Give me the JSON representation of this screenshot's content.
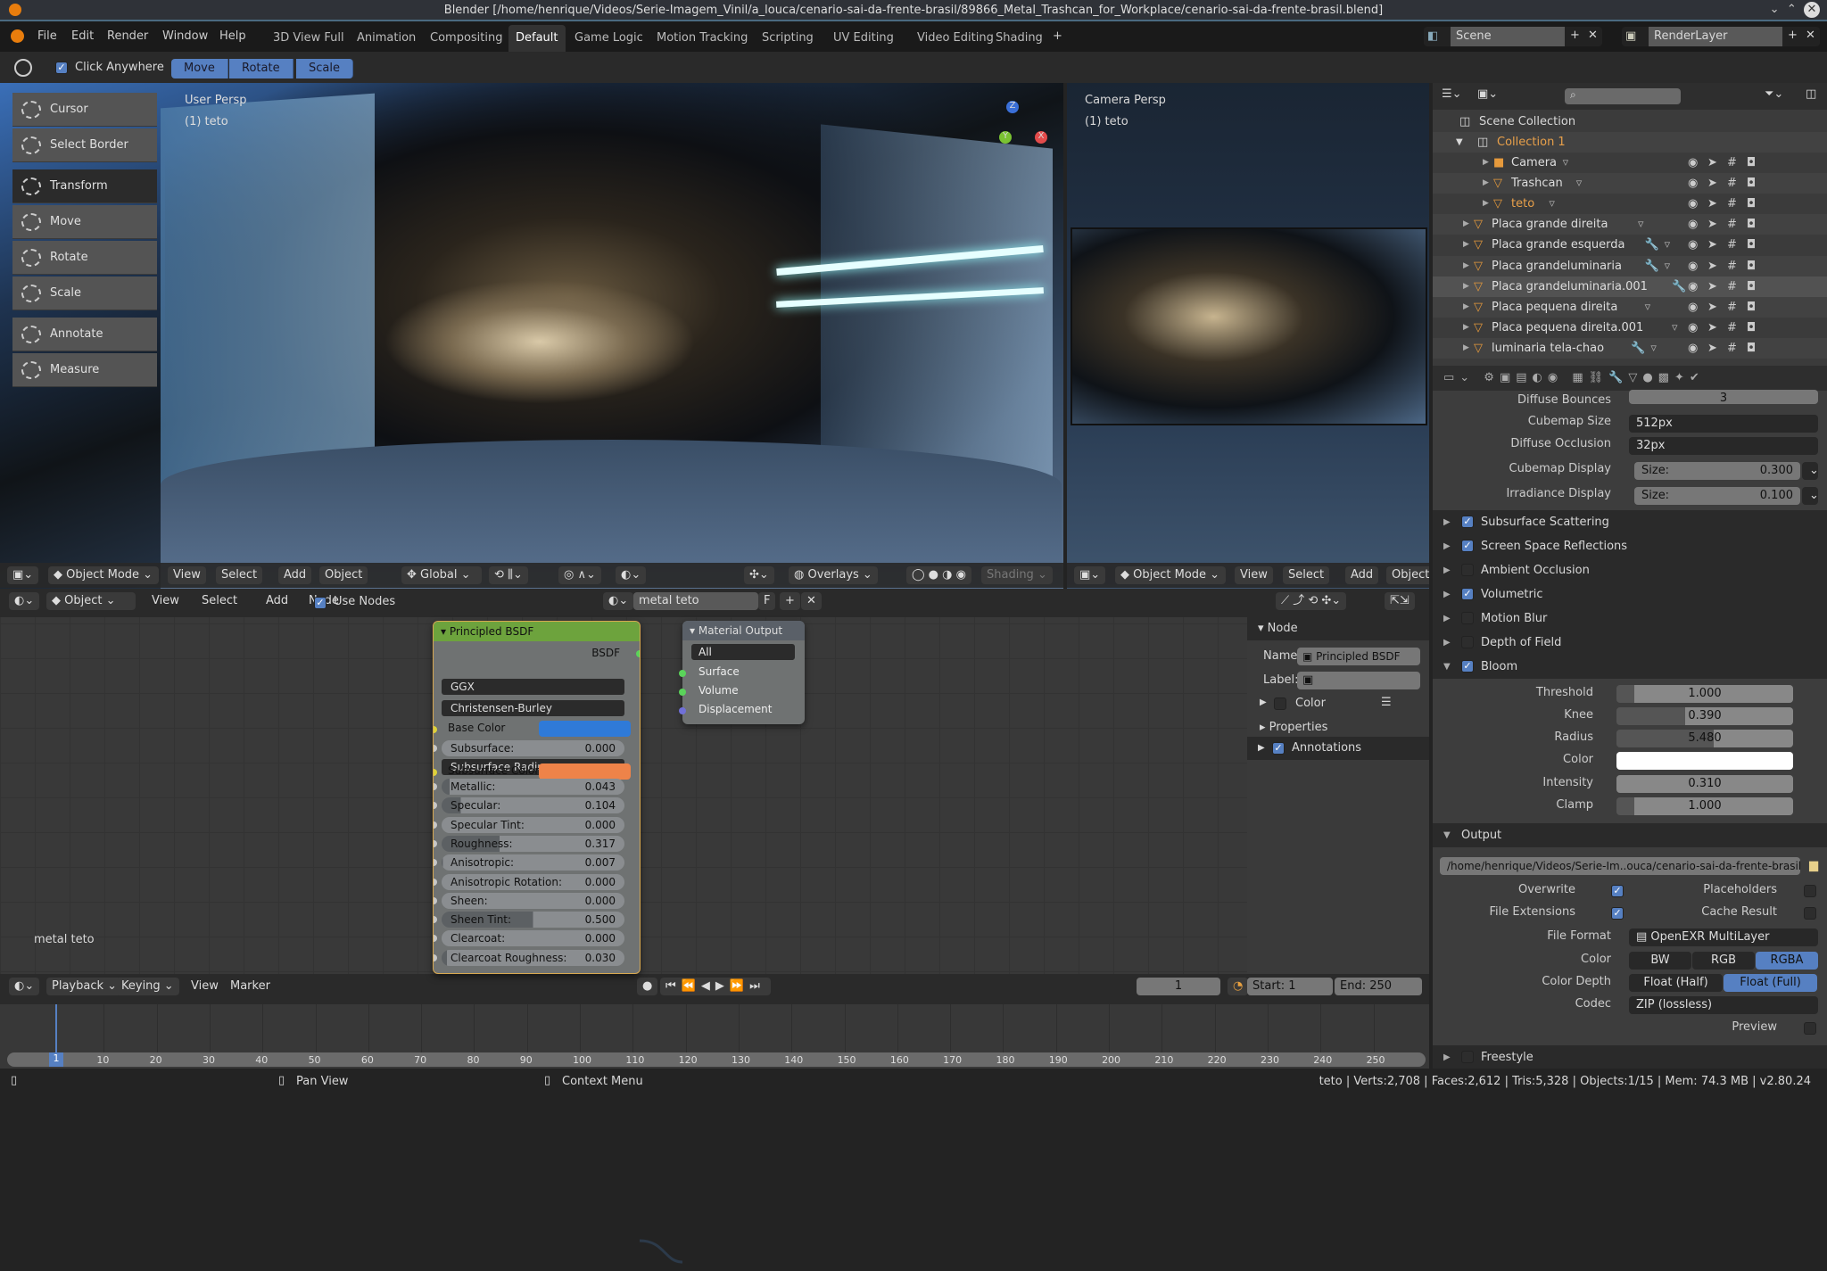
{
  "window": {
    "title": "Blender [/home/henrique/Videos/Serie-Imagem_Vinil/a_louca/cenario-sai-da-frente-brasil/89866_Metal_Trashcan_for_Workplace/cenario-sai-da-frente-brasil.blend]"
  },
  "menu": [
    "File",
    "Edit",
    "Render",
    "Window",
    "Help"
  ],
  "workspaces": [
    {
      "label": "3D View Full"
    },
    {
      "label": "Animation"
    },
    {
      "label": "Compositing"
    },
    {
      "label": "Default",
      "active": true
    },
    {
      "label": "Game Logic"
    },
    {
      "label": "Motion Tracking"
    },
    {
      "label": "Scripting"
    },
    {
      "label": "UV Editing"
    },
    {
      "label": "Video Editing"
    },
    {
      "label": "Shading"
    }
  ],
  "scene": {
    "name": "Scene",
    "layer": "RenderLayer"
  },
  "toolheader": {
    "click_anywhere": "Click Anywhere",
    "modes": [
      "Move",
      "Rotate",
      "Scale"
    ]
  },
  "tools": [
    {
      "label": "Cursor"
    },
    {
      "label": "Select Border"
    },
    {
      "label": "Transform",
      "active": true
    },
    {
      "label": "Move"
    },
    {
      "label": "Rotate"
    },
    {
      "label": "Scale"
    },
    {
      "label": "Annotate"
    },
    {
      "label": "Measure"
    }
  ],
  "viewport": {
    "persp": "User Persp",
    "object": "(1) teto",
    "mode": "Object Mode",
    "menus": [
      "View",
      "Select",
      "Add",
      "Object"
    ],
    "orientation": "Global",
    "overlays": "Overlays",
    "shading": "Shading"
  },
  "camera_view": {
    "persp": "Camera Persp",
    "object": "(1) teto",
    "mode": "Object Mode",
    "menus": [
      "View",
      "Select",
      "Add",
      "Object"
    ]
  },
  "outliner": {
    "root": "Scene Collection",
    "collection": "Collection 1",
    "items": [
      {
        "name": "Camera",
        "depth": 2
      },
      {
        "name": "Trashcan",
        "depth": 2
      },
      {
        "name": "teto",
        "depth": 2,
        "active": true
      },
      {
        "name": "Placa grande direita",
        "depth": 1
      },
      {
        "name": "Placa grande esquerda",
        "depth": 1,
        "mod": true
      },
      {
        "name": "Placa grandeluminaria",
        "depth": 1,
        "mod": true
      },
      {
        "name": "Placa grandeluminaria.001",
        "depth": 1,
        "mod": true,
        "selected": true
      },
      {
        "name": "Placa pequena direita",
        "depth": 1
      },
      {
        "name": "Placa pequena direita.001",
        "depth": 1
      },
      {
        "name": "luminaria tela-chao",
        "depth": 1,
        "mod": true
      }
    ]
  },
  "properties": {
    "top": [
      {
        "label": "Diffuse Bounces",
        "value": "3",
        "kind": "slider"
      },
      {
        "label": "Cubemap Size",
        "value": "512px",
        "kind": "dropdown"
      },
      {
        "label": "Diffuse Occlusion",
        "value": "32px",
        "kind": "dropdown"
      },
      {
        "label": "Cubemap Display",
        "value": "0.300",
        "prefix": "Size:",
        "kind": "size"
      },
      {
        "label": "Irradiance Display",
        "value": "0.100",
        "prefix": "Size:",
        "kind": "size"
      }
    ],
    "sections": [
      {
        "label": "Subsurface Scattering",
        "checked": true
      },
      {
        "label": "Screen Space Reflections",
        "checked": true
      },
      {
        "label": "Ambient Occlusion",
        "checked": false
      },
      {
        "label": "Volumetric",
        "checked": true
      },
      {
        "label": "Motion Blur",
        "checked": false
      },
      {
        "label": "Depth of Field",
        "checked": false
      },
      {
        "label": "Bloom",
        "checked": true,
        "open": true
      }
    ],
    "bloom": [
      {
        "label": "Threshold",
        "value": "1.000",
        "fill": 0.1
      },
      {
        "label": "Knee",
        "value": "0.390",
        "fill": 0.39
      },
      {
        "label": "Radius",
        "value": "5.480",
        "fill": 0.55
      },
      {
        "label": "Color",
        "value": "",
        "color": "#ffffff"
      },
      {
        "label": "Intensity",
        "value": "0.310",
        "fill": 0
      },
      {
        "label": "Clamp",
        "value": "1.000",
        "fill": 0.1
      }
    ],
    "output": {
      "title": "Output",
      "path": "/home/henrique/Videos/Serie-Im..ouca/cenario-sai-da-frente-brasil/",
      "overwrite": "Overwrite",
      "placeholders": "Placeholders",
      "file_extensions": "File Extensions",
      "cache_result": "Cache Result",
      "file_format_label": "File Format",
      "file_format": "OpenEXR MultiLayer",
      "color_label": "Color",
      "color_opts": [
        "BW",
        "RGB",
        "RGBA"
      ],
      "color_sel": "RGBA",
      "depth_label": "Color Depth",
      "depth_opts": [
        "Float (Half)",
        "Float (Full)"
      ],
      "depth_sel": "Float (Full)",
      "codec_label": "Codec",
      "codec": "ZIP (lossless)",
      "preview": "Preview"
    },
    "freestyle": "Freestyle"
  },
  "node_editor": {
    "object": "Object",
    "menus": [
      "View",
      "Select",
      "Add",
      "Node"
    ],
    "use_nodes": "Use Nodes",
    "material": "metal teto",
    "fake": "F",
    "material_label": "metal teto",
    "bsdf": {
      "title": "Principled BSDF",
      "output": "BSDF",
      "distribution": "GGX",
      "subsurface_method": "Christensen-Burley",
      "base_color_label": "Base Color",
      "base_color": "#2f7ad8",
      "subsurface_color_label": "Subsurface Color",
      "subsurface_color": "#ee8349",
      "subsurface_radius": "Subsurface Radius",
      "fields": [
        {
          "label": "Subsurface:",
          "value": "0.000",
          "fill": 0
        },
        {
          "label": "Metallic:",
          "value": "0.043",
          "fill": 0.043
        },
        {
          "label": "Specular:",
          "value": "0.104",
          "fill": 0.104
        },
        {
          "label": "Specular Tint:",
          "value": "0.000",
          "fill": 0
        },
        {
          "label": "Roughness:",
          "value": "0.317",
          "fill": 0.317
        },
        {
          "label": "Anisotropic:",
          "value": "0.007",
          "fill": 0.007
        },
        {
          "label": "Anisotropic Rotation:",
          "value": "0.000",
          "fill": 0
        },
        {
          "label": "Sheen:",
          "value": "0.000",
          "fill": 0
        },
        {
          "label": "Sheen Tint:",
          "value": "0.500",
          "fill": 0.5
        },
        {
          "label": "Clearcoat:",
          "value": "0.000",
          "fill": 0
        },
        {
          "label": "Clearcoat Roughness:",
          "value": "0.030",
          "fill": 0.03
        }
      ]
    },
    "output_node": {
      "title": "Material Output",
      "target": "All",
      "sockets": [
        "Surface",
        "Volume",
        "Displacement"
      ]
    },
    "sidebar": {
      "section": "Node",
      "name_label": "Name:",
      "name": "Principled BSDF",
      "label_label": "Label:",
      "label": "",
      "color": "Color",
      "properties": "Properties",
      "annotations": "Annotations"
    }
  },
  "timeline": {
    "menus": [
      "Playback",
      "Keying",
      "View",
      "Marker"
    ],
    "current": "1",
    "start_label": "Start:",
    "start": "1",
    "end_label": "End:",
    "end": "250",
    "ticks": [
      10,
      20,
      30,
      40,
      50,
      60,
      70,
      80,
      90,
      100,
      110,
      120,
      130,
      140,
      150,
      160,
      170,
      180,
      190,
      200,
      210,
      220,
      230,
      240,
      250
    ]
  },
  "status": {
    "pan": "Pan View",
    "context": "Context Menu",
    "stats": "teto | Verts:2,708 | Faces:2,612 | Tris:5,328 | Objects:1/15 | Mem: 74.3 MB | v2.80.24"
  }
}
